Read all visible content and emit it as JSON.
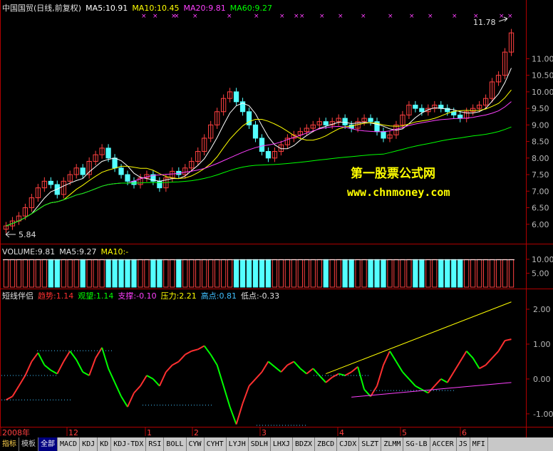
{
  "panels": {
    "price": {
      "header": [
        {
          "text": "中国国贸(日线,前复权)",
          "color": "#e0e0e0"
        },
        {
          "text": "MA5:10.91",
          "color": "#ffffff"
        },
        {
          "text": "MA10:10.45",
          "color": "#ffff00"
        },
        {
          "text": "MA20:9.81",
          "color": "#ff40ff"
        },
        {
          "text": "MA60:9.27",
          "color": "#00ff00"
        }
      ],
      "high_label": "11.78",
      "low_label": "5.84",
      "watermark_title": "第一股票公式网",
      "watermark_url": "www.chnmoney.com"
    },
    "volume": {
      "header": [
        {
          "text": "VOLUME:9.81",
          "color": "#e0e0e0"
        },
        {
          "text": "MA5:9.27",
          "color": "#e0e0e0"
        },
        {
          "text": "MA10:-",
          "color": "#ffff00"
        }
      ]
    },
    "indicator": {
      "header": [
        {
          "text": "短线伴侣",
          "color": "#e0e0e0"
        },
        {
          "text": "趋势:1.14",
          "color": "#ff3030"
        },
        {
          "text": "观望:1.14",
          "color": "#00ff00"
        },
        {
          "text": "支撑:-0.10",
          "color": "#ff40ff"
        },
        {
          "text": "压力:2.21",
          "color": "#ffff00"
        },
        {
          "text": "高点:0.81",
          "color": "#40c0ff"
        },
        {
          "text": "低点:-0.33",
          "color": "#e0e0e0"
        }
      ]
    }
  },
  "time_axis": [
    "2008年",
    "12",
    "1",
    "2",
    "3",
    "4",
    "5",
    "6"
  ],
  "tabs": [
    "指标",
    "模板",
    "全部",
    "MACD",
    "KDJ",
    "KD",
    "KDJ-TDX",
    "RSI",
    "BOLL",
    "CYW",
    "CYHT",
    "LYJH",
    "SDLH",
    "LHXJ",
    "BDZX",
    "ZBCD",
    "CJDX",
    "SLZT",
    "ZLMM",
    "SG-LB",
    "ACCER",
    "JS",
    "MFI"
  ],
  "active_tab": "全部",
  "chart_data": [
    {
      "type": "candlestick",
      "title": "中国国贸(日线,前复权)",
      "ylim": [
        5.5,
        12.3
      ],
      "yticks": [
        6.0,
        6.5,
        7.0,
        7.5,
        8.0,
        8.5,
        9.0,
        9.5,
        10.0,
        10.5,
        11.0
      ],
      "series_close": [
        5.95,
        6.1,
        6.25,
        6.5,
        6.8,
        7.1,
        7.3,
        7.2,
        6.9,
        7.3,
        7.5,
        7.7,
        7.5,
        7.9,
        8.1,
        8.3,
        8.0,
        7.7,
        7.5,
        7.3,
        7.2,
        7.4,
        7.5,
        7.3,
        7.1,
        7.4,
        7.6,
        7.5,
        7.7,
        7.9,
        8.2,
        8.6,
        9.0,
        9.4,
        9.8,
        10.0,
        9.7,
        9.4,
        9.0,
        8.6,
        8.2,
        8.0,
        8.2,
        8.4,
        8.6,
        8.7,
        8.8,
        8.9,
        9.0,
        9.1,
        9.0,
        9.1,
        9.2,
        9.0,
        8.9,
        9.1,
        9.2,
        9.1,
        8.8,
        8.6,
        8.7,
        9.0,
        9.3,
        9.6,
        9.5,
        9.4,
        9.5,
        9.6,
        9.5,
        9.4,
        9.3,
        9.2,
        9.4,
        9.5,
        9.6,
        9.8,
        10.3,
        10.5,
        11.2,
        11.78
      ],
      "moving_averages": [
        {
          "name": "MA5",
          "last": 10.91
        },
        {
          "name": "MA10",
          "last": 10.45
        },
        {
          "name": "MA20",
          "last": 9.81
        },
        {
          "name": "MA60",
          "last": 9.27
        }
      ],
      "annotations": [
        "11.78",
        "5.84"
      ]
    },
    {
      "type": "bar",
      "title": "VOLUME",
      "ylim": [
        0,
        11
      ],
      "yticks": [
        5.0,
        10.0
      ],
      "values": [
        9.9,
        9.9,
        9.9,
        9.9,
        9.9,
        9.9,
        9.9,
        9.9,
        9.9,
        9.9,
        9.9,
        9.9,
        9.9,
        9.9,
        9.9,
        9.9,
        9.9,
        9.9,
        9.9,
        9.9,
        9.9,
        9.9,
        9.9,
        9.9,
        9.9,
        9.9,
        9.9,
        9.9,
        9.9,
        9.9,
        9.9,
        9.9,
        9.9,
        9.9,
        9.9,
        9.9,
        9.9,
        9.9,
        9.9,
        9.9,
        9.9,
        9.9,
        9.9,
        9.9,
        9.9,
        9.9,
        9.9,
        9.9,
        9.9,
        9.9,
        9.9,
        9.9,
        9.9,
        9.9,
        9.9,
        9.9,
        9.9,
        9.9,
        9.9,
        9.9,
        9.9,
        9.9,
        9.9,
        9.9,
        9.9,
        9.9,
        9.9,
        9.9,
        9.9,
        9.9,
        9.9,
        9.9,
        9.9,
        9.9,
        9.9,
        9.9,
        9.9,
        9.9,
        9.9,
        9.9
      ],
      "legend": [
        "VOLUME:9.81",
        "MA5:9.27",
        "MA10:-"
      ]
    },
    {
      "type": "line",
      "title": "短线伴侣",
      "ylim": [
        -1.35,
        2.45
      ],
      "yticks": [
        -1.0,
        0.0,
        1.0,
        2.0
      ],
      "ytick_labels": [
        "-1.00",
        "0.00",
        "1.00",
        "2.00"
      ],
      "series": [
        {
          "name": "趋势",
          "last": 1.14,
          "values": [
            -0.6,
            -0.5,
            -0.2,
            0.1,
            0.5,
            0.75,
            0.4,
            0.25,
            0.15,
            0.5,
            0.8,
            0.55,
            0.2,
            0.1,
            0.6,
            0.9,
            0.3,
            -0.1,
            -0.5,
            -0.8,
            -0.4,
            -0.2,
            0.1,
            0.0,
            -0.2,
            0.2,
            0.4,
            0.5,
            0.7,
            0.8,
            0.85,
            0.95,
            0.7,
            0.4,
            -0.2,
            -0.8,
            -1.3,
            -0.7,
            -0.2,
            0.0,
            0.2,
            0.5,
            0.35,
            0.2,
            0.4,
            0.5,
            0.3,
            0.15,
            0.3,
            0.1,
            -0.1,
            0.05,
            0.15,
            0.1,
            0.2,
            0.35,
            -0.3,
            -0.5,
            -0.2,
            0.4,
            0.8,
            0.5,
            0.2,
            0.0,
            -0.2,
            -0.3,
            -0.4,
            -0.2,
            0.0,
            -0.1,
            0.2,
            0.5,
            0.8,
            0.6,
            0.3,
            0.4,
            0.6,
            0.8,
            1.1,
            1.14
          ]
        },
        {
          "name": "观望",
          "last": 1.14
        },
        {
          "name": "支撑",
          "last": -0.1
        },
        {
          "name": "压力",
          "last": 2.21
        },
        {
          "name": "高点",
          "last": 0.81
        },
        {
          "name": "低点",
          "last": -0.33
        }
      ]
    }
  ]
}
